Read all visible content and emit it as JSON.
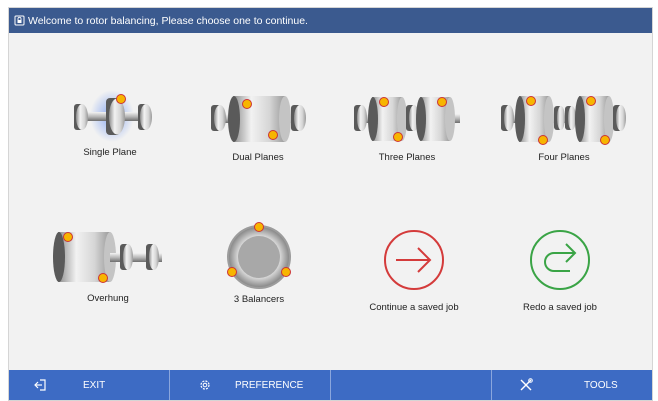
{
  "titlebar": {
    "text": "Welcome to rotor balancing, Please choose one to continue."
  },
  "tiles": [
    {
      "label": "Single Plane"
    },
    {
      "label": "Dual Planes"
    },
    {
      "label": "Three Planes"
    },
    {
      "label": "Four Planes"
    },
    {
      "label": "Overhung"
    },
    {
      "label": "3 Balancers"
    },
    {
      "label": "Continue a saved job"
    },
    {
      "label": "Redo a saved job"
    }
  ],
  "bottombar": {
    "exit": "EXIT",
    "preference": "PREFERENCE",
    "tools": "TOOLS"
  },
  "colors": {
    "titlebar": "#3b5a8f",
    "bottombar": "#3d6bc4",
    "weight": "#f7b500",
    "continue": "#d43b3b",
    "redo": "#3aa446"
  },
  "icons": [
    "lock-icon",
    "exit-icon",
    "gear-icon",
    "tools-icon",
    "arrow-right-icon",
    "redo-arrow-icon"
  ]
}
